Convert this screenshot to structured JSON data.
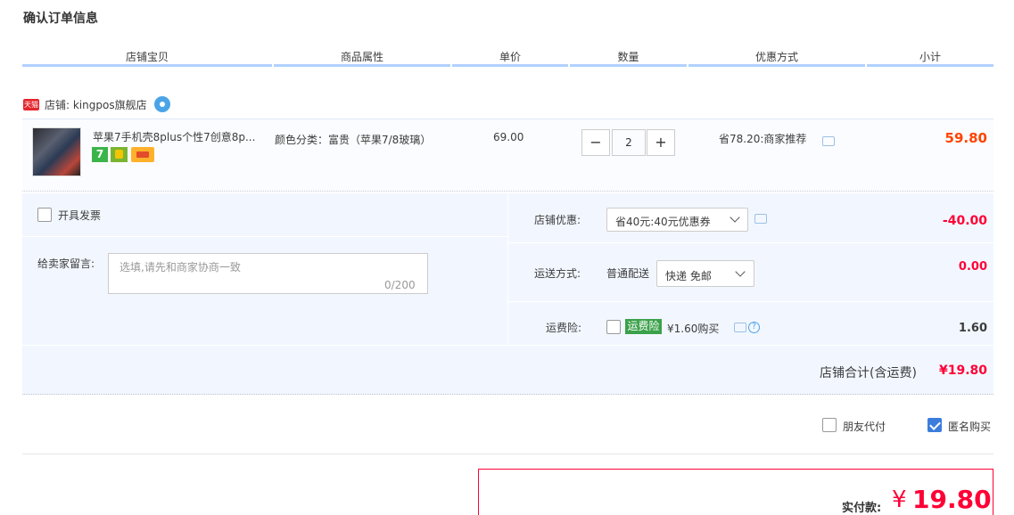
{
  "page": {
    "title": "确认订单信息"
  },
  "headers": [
    "店铺宝贝",
    "商品属性",
    "单价",
    "数量",
    "优惠方式",
    "小计"
  ],
  "shop": {
    "badge": "天猫",
    "label": "店铺: kingpos旗舰店"
  },
  "item": {
    "title": "苹果7手机壳8plus个性7创意8p...",
    "tag_7": "7",
    "attr": "颜色分类：富贵（苹果7/8玻璃）",
    "unit_price": "69.00",
    "qty_minus": "−",
    "qty": "2",
    "qty_plus": "+",
    "discount": "省78.20:商家推荐",
    "subtotal": "59.80"
  },
  "options": {
    "invoice_label": "开具发票",
    "note_label": "给卖家留言:",
    "note_placeholder": "选填,请先和商家协商一致",
    "note_count": "0/200",
    "coupon_label": "店铺优惠:",
    "coupon_select": "省40元:40元优惠券",
    "coupon_amount": "-40.00",
    "ship_label": "运送方式:",
    "ship_type": "普通配送",
    "ship_select": "快递 免邮",
    "ship_amount": "0.00",
    "ins_label": "运费险:",
    "ins_tag": "运费险",
    "ins_price": "¥1.60购买",
    "ins_help": "?",
    "ins_amount": "1.60",
    "total_label": "店铺合计(含运费)",
    "total_amount": "¥19.80"
  },
  "extras": {
    "friend_pay": "朋友代付",
    "anonymous": "匿名购买",
    "anonymous_checked": true
  },
  "payment": {
    "label": "实付款:",
    "currency": "¥",
    "amount": "19.80"
  },
  "colors": {
    "accent_red": "#ff0036",
    "header_line": "#b2d1ff",
    "panel_bg": "#f2f7ff"
  }
}
